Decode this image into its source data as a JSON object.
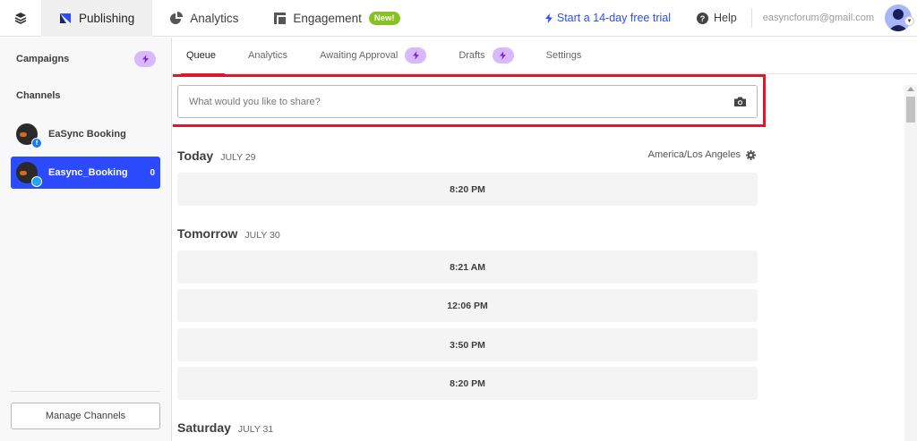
{
  "topnav": {
    "publishing": "Publishing",
    "analytics": "Analytics",
    "engagement": "Engagement",
    "new_badge": "New!",
    "trial": "Start a 14-day free trial",
    "help": "Help",
    "email": "easyncforum@gmail.com"
  },
  "sidebar": {
    "campaigns": "Campaigns",
    "channels": "Channels",
    "channel_list": [
      {
        "name": "EaSync Booking",
        "network": "facebook"
      },
      {
        "name": "Easync_Booking",
        "network": "twitter",
        "count": "0"
      }
    ],
    "manage": "Manage Channels"
  },
  "subtabs": {
    "queue": "Queue",
    "analytics": "Analytics",
    "awaiting": "Awaiting Approval",
    "drafts": "Drafts",
    "settings": "Settings"
  },
  "composer": {
    "placeholder": "What would you like to share?"
  },
  "timezone": "America/Los Angeles",
  "days": [
    {
      "name": "Today",
      "date": "JULY 29",
      "slots": [
        "8:20 PM"
      ]
    },
    {
      "name": "Tomorrow",
      "date": "JULY 30",
      "slots": [
        "8:21 AM",
        "12:06 PM",
        "3:50 PM",
        "8:20 PM"
      ]
    },
    {
      "name": "Saturday",
      "date": "JULY 31",
      "slots": []
    }
  ],
  "colors": {
    "accent": "#2c4bff",
    "highlight": "#e2162b",
    "bolt_pill": "#d9b8ff",
    "new_badge": "#87c221"
  }
}
